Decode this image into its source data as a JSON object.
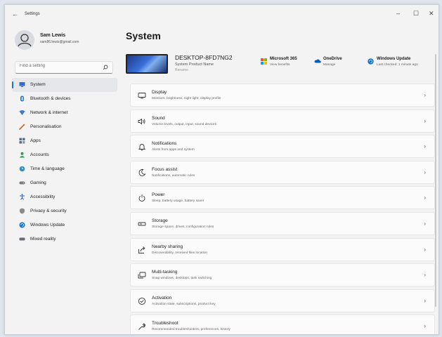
{
  "window": {
    "app_title": "Settings",
    "back_glyph": "←",
    "controls": {
      "minimize": "–",
      "maximize": "☐",
      "close": "✕"
    }
  },
  "profile": {
    "name": "Sam Lewis",
    "email": "sam86.lewis@gmail.com"
  },
  "search": {
    "placeholder": "Find a setting"
  },
  "sidebar": {
    "items": [
      {
        "label": "System",
        "icon": "system-icon",
        "active": true,
        "color": "#2f6fc9"
      },
      {
        "label": "Bluetooth & devices",
        "icon": "bluetooth-icon",
        "color": "#1a73c8"
      },
      {
        "label": "Network & internet",
        "icon": "network-icon",
        "color": "#3a7bd5"
      },
      {
        "label": "Personalisation",
        "icon": "brush-icon",
        "color": "#c86a2a"
      },
      {
        "label": "Apps",
        "icon": "apps-icon",
        "color": "#5a6a7a"
      },
      {
        "label": "Accounts",
        "icon": "accounts-icon",
        "color": "#2e9a5a"
      },
      {
        "label": "Time & language",
        "icon": "globe-clock-icon",
        "color": "#2a8fc7"
      },
      {
        "label": "Gaming",
        "icon": "gamepad-icon",
        "color": "#7a7a7a"
      },
      {
        "label": "Accessibility",
        "icon": "accessibility-icon",
        "color": "#1d5fb8"
      },
      {
        "label": "Privacy & security",
        "icon": "shield-icon",
        "color": "#8a8a8a"
      },
      {
        "label": "Windows Update",
        "icon": "update-icon",
        "color": "#1a73c8"
      },
      {
        "label": "Mixed reality",
        "icon": "headset-icon",
        "color": "#6a6a7a"
      }
    ]
  },
  "main": {
    "title": "System",
    "device": {
      "name": "DESKTOP-8FD7NG2",
      "model": "System Product Name",
      "rename": "Rename"
    },
    "quick": [
      {
        "title": "Microsoft 365",
        "sub": "View benefits",
        "icon": "microsoft-icon"
      },
      {
        "title": "OneDrive",
        "sub": "Manage",
        "icon": "onedrive-icon"
      },
      {
        "title": "Windows Update",
        "sub": "Last checked: 1 minute ago",
        "icon": "windows-update-icon"
      }
    ],
    "rows": [
      {
        "title": "Display",
        "sub": "Monitors, brightness, night light, display profile",
        "icon": "display-icon"
      },
      {
        "title": "Sound",
        "sub": "Volume levels, output, input, sound devices",
        "icon": "sound-icon"
      },
      {
        "title": "Notifications",
        "sub": "Alerts from apps and system",
        "icon": "bell-icon"
      },
      {
        "title": "Focus assist",
        "sub": "Notifications, automatic rules",
        "icon": "moon-icon"
      },
      {
        "title": "Power",
        "sub": "Sleep, battery usage, battery saver",
        "icon": "power-icon"
      },
      {
        "title": "Storage",
        "sub": "Storage space, drives, configuration rules",
        "icon": "storage-icon"
      },
      {
        "title": "Nearby sharing",
        "sub": "Discoverability, received files location",
        "icon": "share-icon"
      },
      {
        "title": "Multi-tasking",
        "sub": "Snap windows, desktops, task switching",
        "icon": "multitask-icon"
      },
      {
        "title": "Activation",
        "sub": "Activation state, subscriptions, product key",
        "icon": "activation-icon"
      },
      {
        "title": "Troubleshoot",
        "sub": "Recommended troubleshooters, preferences, history",
        "icon": "wrench-icon"
      }
    ],
    "chevron": "›"
  }
}
